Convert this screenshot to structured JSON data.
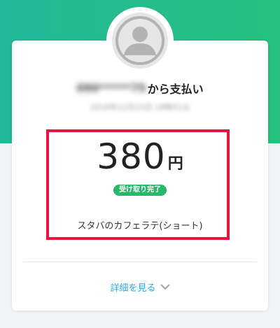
{
  "payment": {
    "payer_name": "090******75",
    "payer_suffix": "から支払い",
    "timestamp": "2018年12月15日 18時01分",
    "amount": "380",
    "currency_unit": "円",
    "status": "受け取り完了",
    "memo": "スタバのカフェラテ(ショート)"
  },
  "footer": {
    "details_label": "詳細を見る"
  },
  "icons": {
    "avatar": "person-icon",
    "details": "chevron-down-icon"
  },
  "colors": {
    "header_gradient_start": "#22b89a",
    "header_gradient_end": "#27c07e",
    "highlight_border": "#e8163f",
    "status_badge": "#27b86a",
    "link": "#2aa8e0"
  }
}
